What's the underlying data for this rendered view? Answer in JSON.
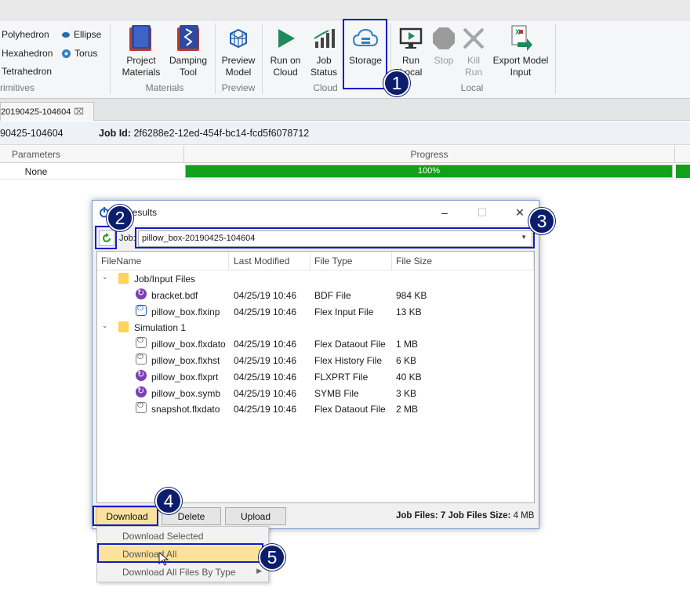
{
  "ribbon": {
    "primitives": {
      "items": [
        "Polyhedron",
        "Ellipse",
        "Hexahedron",
        "Torus",
        "Tetrahedron"
      ],
      "group_label": "rimitives"
    },
    "materials": {
      "buttons": [
        "Project\nMaterials",
        "Damping\nTool"
      ],
      "project_materials_1": "Project",
      "project_materials_2": "Materials",
      "damping_1": "Damping",
      "damping_2": "Tool",
      "group_label": "Materials"
    },
    "preview": {
      "btn_1": "Preview",
      "btn_2": "Model",
      "group_label": "Preview"
    },
    "cloud": {
      "run_on_cloud_1": "Run on",
      "run_on_cloud_2": "Cloud",
      "job_status_1": "Job",
      "job_status_2": "Status",
      "storage": "Storage",
      "group_label": "Cloud"
    },
    "local": {
      "run_local_1": "Run",
      "run_local_2": "Local",
      "stop": "Stop",
      "kill_run_1": "Kill",
      "kill_run_2": "Run",
      "export_1": "Export Model",
      "export_2": "Input",
      "group_label": "Local"
    }
  },
  "doc_tab": {
    "label": "20190425-104604",
    "close_glyph": "⌧"
  },
  "job_info": {
    "name": "90425-104604",
    "id_label": "Job Id:",
    "id_value": "2f6288e2-12ed-454f-bc14-fcd5f6078712"
  },
  "grid": {
    "headers": [
      "Parameters",
      "Progress"
    ],
    "row": {
      "parameters": "None",
      "progress_text": "100%",
      "progress_value": 1.0
    }
  },
  "dialog": {
    "title": "d Results",
    "minimize": "–",
    "maximize": "☐",
    "close": "✕",
    "job_label": "Job:",
    "job_value": "pillow_box-20190425-104604",
    "columns": [
      "FileName",
      "Last Modified",
      "File Type",
      "File Size"
    ],
    "groups": [
      {
        "name": "Job/Input Files",
        "files": [
          {
            "name": "bracket.bdf",
            "modified": "04/25/19 10:46",
            "type": "BDF File",
            "size": "984 KB",
            "icon": "purple"
          },
          {
            "name": "pillow_box.flxinp",
            "modified": "04/25/19 10:46",
            "type": "Flex Input File",
            "size": "13 KB",
            "icon": "blue"
          }
        ]
      },
      {
        "name": "Simulation 1",
        "files": [
          {
            "name": "pillow_box.flxdato",
            "modified": "04/25/19 10:46",
            "type": "Flex Dataout File",
            "size": "1 MB",
            "icon": "gray"
          },
          {
            "name": "pillow_box.flxhst",
            "modified": "04/25/19 10:46",
            "type": "Flex History File",
            "size": "6 KB",
            "icon": "gray"
          },
          {
            "name": "pillow_box.flxprt",
            "modified": "04/25/19 10:46",
            "type": "FLXPRT File",
            "size": "40 KB",
            "icon": "purple"
          },
          {
            "name": "pillow_box.symb",
            "modified": "04/25/19 10:46",
            "type": "SYMB File",
            "size": "3 KB",
            "icon": "purple"
          },
          {
            "name": "snapshot.flxdato",
            "modified": "04/25/19 10:46",
            "type": "Flex Dataout File",
            "size": "2 MB",
            "icon": "gray"
          }
        ]
      }
    ],
    "download_btn": "Download",
    "delete_btn": "Delete",
    "upload_btn": "Upload",
    "summary_files_label": "Job Files:",
    "summary_files_value": "7",
    "summary_size_label": "Job Files Size:",
    "summary_size_value": "4 MB"
  },
  "download_menu": {
    "items": [
      "Download Selected",
      "Download All",
      "Download All Files By Type"
    ]
  },
  "annotations": [
    "1",
    "2",
    "3",
    "4",
    "5"
  ],
  "colors": {
    "callout": "#0c1ec4",
    "badge": "#0d1d6e",
    "progress": "#11a01a",
    "highlight": "#fde29b"
  }
}
